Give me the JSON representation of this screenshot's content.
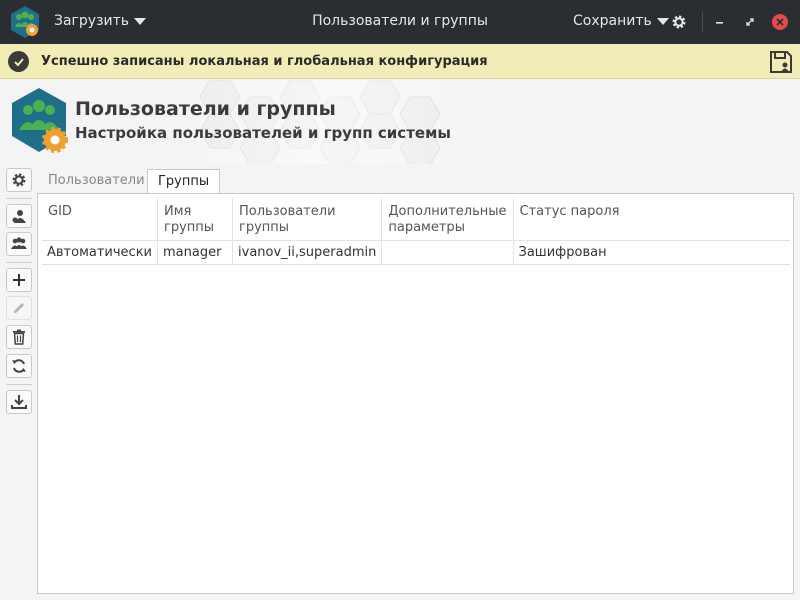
{
  "titlebar": {
    "load_label": "Загрузить",
    "title": "Пользователи и группы",
    "save_label": "Сохранить"
  },
  "notification": {
    "text": "Успешно записаны локальная и глобальная конфигурация"
  },
  "header": {
    "title": "Пользователи и группы",
    "subtitle": "Настройка пользователей и групп системы"
  },
  "tabs": [
    {
      "label": "Пользователи",
      "active": false
    },
    {
      "label": "Группы",
      "active": true
    }
  ],
  "table": {
    "columns": [
      "GID",
      "Имя группы",
      "Пользователи группы",
      "Дополнительные параметры",
      "Статус пароля"
    ],
    "rows": [
      [
        "Автоматически",
        "manager",
        "ivanov_ii,superadmin",
        "",
        "Зашифрован"
      ]
    ]
  },
  "icons": {
    "app": "users-gear-icon",
    "settings": "gear-icon",
    "minimize": "minimize-icon",
    "restore": "restore-icon",
    "close": "close-icon",
    "notification": "check-circle-icon",
    "save_config": "floppy-user-icon",
    "side": [
      "gear-icon",
      "user-icon",
      "group-icon",
      "plus-icon",
      "pencil-icon",
      "trash-icon",
      "refresh-icon",
      "download-icon"
    ]
  },
  "colors": {
    "titlebar_bg": "#2a2e32",
    "notification_bg": "#f2ecb6",
    "app_icon_blue": "#1f6f8b",
    "app_icon_green": "#4caf50",
    "gear_orange": "#f0a030",
    "close_red": "#e34b4b"
  }
}
